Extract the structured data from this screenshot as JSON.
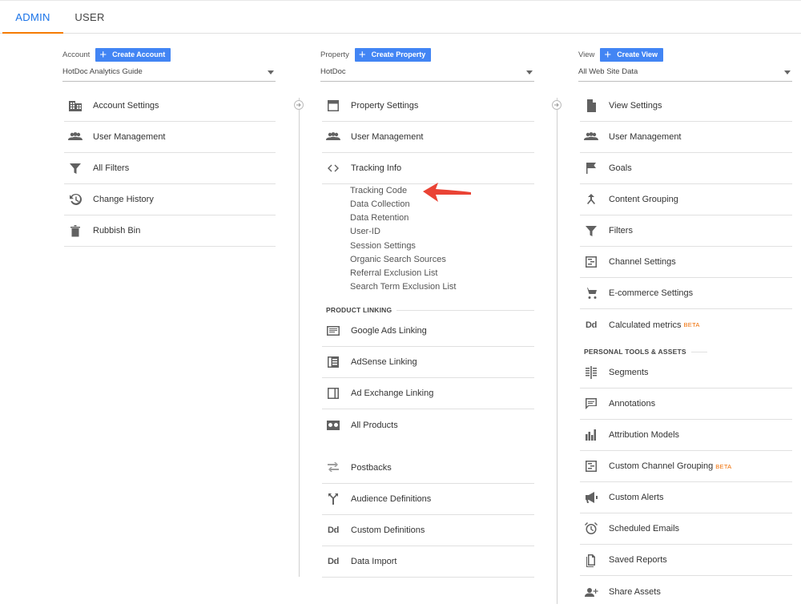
{
  "tabs": {
    "admin": "ADMIN",
    "user": "USER"
  },
  "account": {
    "label": "Account",
    "create": "Create Account",
    "selected": "HotDoc Analytics Guide",
    "items": {
      "settings": "Account Settings",
      "users": "User Management",
      "filters": "All Filters",
      "history": "Change History",
      "trash": "Rubbish Bin"
    }
  },
  "property": {
    "label": "Property",
    "create": "Create Property",
    "selected": "HotDoc",
    "items": {
      "settings": "Property Settings",
      "users": "User Management",
      "tracking": "Tracking Info",
      "google_ads": "Google Ads Linking",
      "adsense": "AdSense Linking",
      "ad_exchange": "Ad Exchange Linking",
      "all_products": "All Products",
      "postbacks": "Postbacks",
      "audience": "Audience Definitions",
      "custom_defs": "Custom Definitions",
      "data_import": "Data Import"
    },
    "tracking_sub": {
      "code": "Tracking Code",
      "collection": "Data Collection",
      "retention": "Data Retention",
      "userid": "User-ID",
      "session": "Session Settings",
      "organic": "Organic Search Sources",
      "referral": "Referral Exclusion List",
      "search_term": "Search Term Exclusion List"
    },
    "product_linking": "PRODUCT LINKING"
  },
  "view": {
    "label": "View",
    "create": "Create View",
    "selected": "All Web Site Data",
    "items": {
      "settings": "View Settings",
      "users": "User Management",
      "goals": "Goals",
      "content_grouping": "Content Grouping",
      "filters": "Filters",
      "channel": "Channel Settings",
      "ecommerce": "E-commerce Settings",
      "calculated": "Calculated metrics",
      "segments": "Segments",
      "annotations": "Annotations",
      "attribution": "Attribution Models",
      "custom_channel": "Custom Channel Grouping",
      "custom_alerts": "Custom Alerts",
      "scheduled": "Scheduled Emails",
      "saved_reports": "Saved Reports",
      "share": "Share Assets"
    },
    "personal_tools": "PERSONAL TOOLS & ASSETS",
    "beta": "BETA"
  },
  "icons": {
    "dd": "Dd"
  },
  "colors": {
    "accent_blue": "#4285f4",
    "tab_active": "#1a73e8",
    "tab_underline": "#f57c00",
    "beta": "#ef6c00",
    "pointer": "#ea4335"
  }
}
